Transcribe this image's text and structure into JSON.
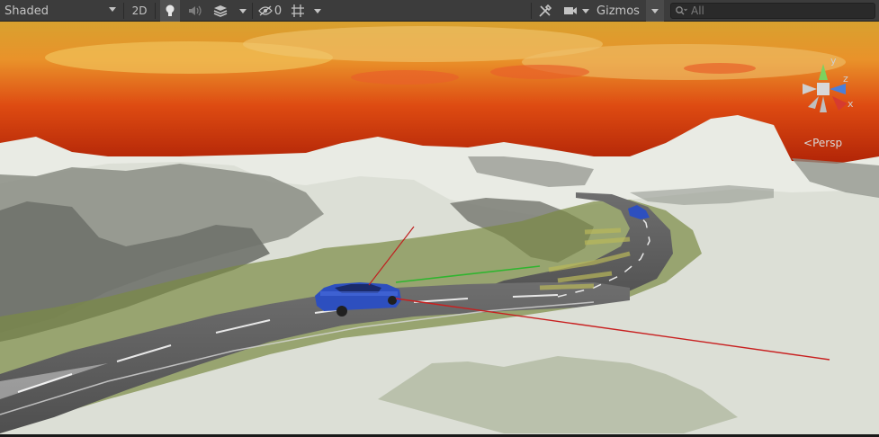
{
  "toolbar": {
    "draw_mode": "Shaded",
    "mode_2d": "2D",
    "hidden_count": "0",
    "gizmos_label": "Gizmos",
    "search_placeholder": "All"
  },
  "gizmo": {
    "y_label": "y",
    "z_label": "z",
    "x_label": "x",
    "projection_label": "Persp"
  }
}
